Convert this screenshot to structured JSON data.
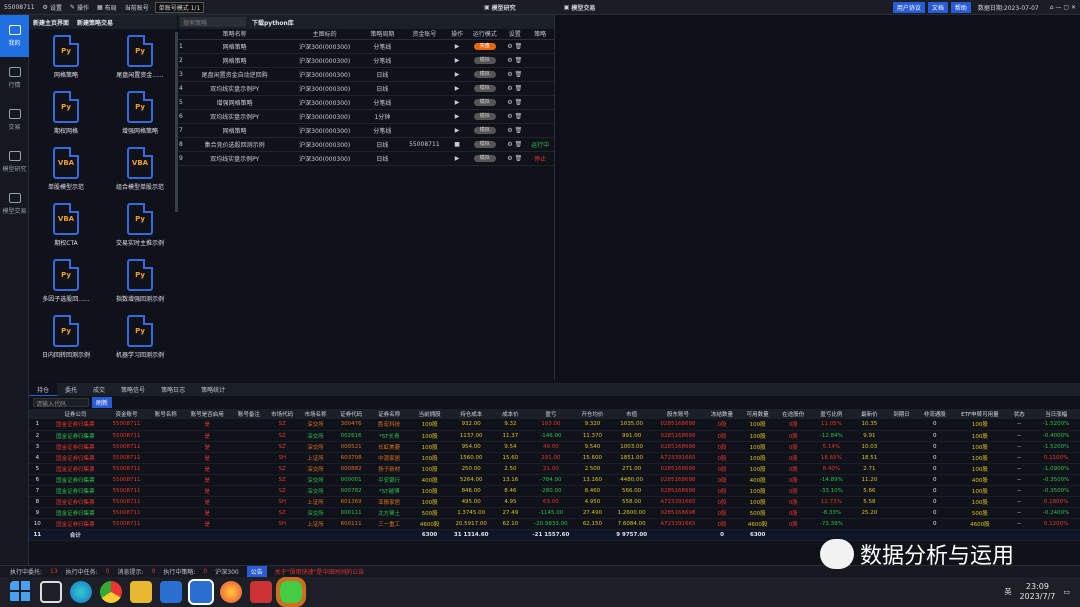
{
  "topbar": {
    "account": "55008711",
    "settings": "设置",
    "operate": "操作",
    "layout": "布局",
    "current_account": "当前账号",
    "mode": "单账号模式 1/1",
    "mid1": "模型研究",
    "mid2": "模型交易",
    "user_agreement": "用户协议",
    "docs": "文档",
    "help": "帮助",
    "date_label": "数据日期:2023-07-07"
  },
  "leftnav": [
    "我的",
    "行情",
    "交易",
    "模型研究",
    "模型交易"
  ],
  "strategy_tabs": [
    "新建主页界面",
    "新建策略交易"
  ],
  "strategies": [
    {
      "type": "Py",
      "name": "网格策略"
    },
    {
      "type": "Py",
      "name": "尾盘闲置资金......"
    },
    {
      "type": "Py",
      "name": "期权网格"
    },
    {
      "type": "Py",
      "name": "增强网格策略"
    },
    {
      "type": "VBA",
      "name": "单股模型示范"
    },
    {
      "type": "VBA",
      "name": "组合模型单股示范"
    },
    {
      "type": "VBA",
      "name": "期权CTA"
    },
    {
      "type": "Py",
      "name": "交易实时主推示例"
    },
    {
      "type": "Py",
      "name": "多因子选股回......"
    },
    {
      "type": "Py",
      "name": "指数增强回测示例"
    },
    {
      "type": "Py",
      "name": "日内回转回测示例"
    },
    {
      "type": "Py",
      "name": "机器学习回测示例"
    }
  ],
  "list": {
    "search_placeholder": "搜索策略",
    "download": "下载python库",
    "headers": [
      "",
      "策略名称",
      "主图标的",
      "策略周期",
      "资金账号",
      "操作",
      "运行模式",
      "设置",
      "策略"
    ],
    "rows": [
      [
        "1",
        "网格策略",
        "沪深300(000300)",
        "分笔线",
        "",
        "▶",
        "实盘",
        "",
        ""
      ],
      [
        "2",
        "网格策略",
        "沪深300(000300)",
        "分笔线",
        "",
        "▶",
        "模拟",
        "",
        ""
      ],
      [
        "3",
        "尾盘闲置资金自动逆回购",
        "沪深300(000300)",
        "日线",
        "",
        "▶",
        "模拟",
        "",
        ""
      ],
      [
        "4",
        "双均线实盘示例PY",
        "沪深300(000300)",
        "日线",
        "",
        "▶",
        "模拟",
        "",
        ""
      ],
      [
        "5",
        "增强网格策略",
        "沪深300(000300)",
        "分笔线",
        "",
        "▶",
        "模拟",
        "",
        ""
      ],
      [
        "6",
        "双均线实盘示例PY",
        "沪深300(000300)",
        "1分钟",
        "",
        "▶",
        "模拟",
        "",
        ""
      ],
      [
        "7",
        "网格策略",
        "沪深300(000300)",
        "分笔线",
        "",
        "▶",
        "模拟",
        "",
        ""
      ],
      [
        "8",
        "集合竞价选股回测示例",
        "沪深300(000300)",
        "日线",
        "55008711",
        "■",
        "模拟",
        "",
        "运行中"
      ],
      [
        "9",
        "双均线实盘示例PY",
        "沪深300(000300)",
        "日线",
        "",
        "▶",
        "模拟",
        "",
        "停止"
      ]
    ]
  },
  "bottom": {
    "tabs": [
      "持仓",
      "委托",
      "成交",
      "策略信号",
      "策略日志",
      "策略统计"
    ],
    "search_placeholder": "请输入代码",
    "search_btn": "刷新",
    "headers": [
      "",
      "证券公司",
      "资金账号",
      "账号名称",
      "账号是否启用",
      "账号备注",
      "市场代码",
      "市场名称",
      "证券代码",
      "证券名称",
      "当前拥股",
      "持仓成本",
      "成本价",
      "盈亏",
      "开仓均价",
      "市值",
      "股东账号",
      "冻结数量",
      "可用数量",
      "在途股份",
      "盈亏比例",
      "最新价",
      "到期日",
      "非流通股",
      "ETF申赎可用量",
      "状态",
      "当日涨幅"
    ],
    "rows": [
      [
        "1",
        "国金证券归集票",
        "55008711",
        "",
        "是",
        "",
        "SZ",
        "深交所",
        "300476",
        "胜宏科技",
        "100股",
        "932.00",
        "9.32",
        "103.00",
        "9.320",
        "1035.00",
        "0285168698",
        "0股",
        "100股",
        "0股",
        "11.05%",
        "10.35",
        "",
        "0",
        "100股",
        "--",
        "-1.5200%"
      ],
      [
        "2",
        "国金证券归集票",
        "55008711",
        "",
        "是",
        "",
        "SZ",
        "深交所",
        "002616",
        "*ST长青",
        "100股",
        "1137.00",
        "11.37",
        "-146.00",
        "11.370",
        "991.00",
        "0285168698",
        "0股",
        "100股",
        "0股",
        "-12.84%",
        "9.91",
        "",
        "0",
        "100股",
        "--",
        "-0.4000%"
      ],
      [
        "3",
        "国金证券归集票",
        "55008711",
        "",
        "是",
        "",
        "SZ",
        "深交所",
        "000521",
        "长虹美菱",
        "100股",
        "954.00",
        "9.54",
        "49.00",
        "9.540",
        "1003.00",
        "0285168698",
        "0股",
        "100股",
        "0股",
        "5.14%",
        "10.03",
        "",
        "0",
        "100股",
        "--",
        "-1.5200%"
      ],
      [
        "4",
        "国金证券归集票",
        "55008711",
        "",
        "是",
        "",
        "SH",
        "上证所",
        "603708",
        "中源家居",
        "100股",
        "1560.00",
        "15.60",
        "291.00",
        "15.600",
        "1851.00",
        "A723391665",
        "0股",
        "100股",
        "0股",
        "18.65%",
        "18.51",
        "",
        "0",
        "100股",
        "--",
        "0.1100%"
      ],
      [
        "5",
        "国金证券归集票",
        "55008711",
        "",
        "是",
        "",
        "SZ",
        "深交所",
        "000882",
        "扬子新材",
        "100股",
        "250.00",
        "2.50",
        "21.00",
        "2.500",
        "271.00",
        "0285168698",
        "0股",
        "100股",
        "0股",
        "8.40%",
        "2.71",
        "",
        "0",
        "100股",
        "--",
        "-1.0900%"
      ],
      [
        "6",
        "国金证券归集票",
        "55008711",
        "",
        "是",
        "",
        "SZ",
        "深交所",
        "000001",
        "平安银行",
        "400股",
        "5264.00",
        "13.16",
        "-784.00",
        "13.160",
        "4480.00",
        "0285168698",
        "0股",
        "400股",
        "0股",
        "-14.89%",
        "11.20",
        "",
        "0",
        "400股",
        "--",
        "-0.3500%"
      ],
      [
        "7",
        "国金证券归集票",
        "55008711",
        "",
        "是",
        "",
        "SZ",
        "深交所",
        "000782",
        "*ST越博",
        "100股",
        "846.00",
        "8.46",
        "-280.00",
        "8.460",
        "566.00",
        "0285168698",
        "0股",
        "100股",
        "0股",
        "-33.10%",
        "5.66",
        "",
        "0",
        "100股",
        "--",
        "-0.3500%"
      ],
      [
        "8",
        "国金证券归集票",
        "55008711",
        "",
        "是",
        "",
        "SH",
        "上证所",
        "601369",
        "亚振家居",
        "100股",
        "495.00",
        "4.95",
        "63.00",
        "4.950",
        "558.00",
        "A723391665",
        "0股",
        "100股",
        "0股",
        "12.73%",
        "5.58",
        "",
        "0",
        "100股",
        "--",
        "0.1800%"
      ],
      [
        "9",
        "国金证券归集票",
        "55008711",
        "",
        "是",
        "",
        "SZ",
        "深交所",
        "000111",
        "北方稀土",
        "500股",
        "1.3745.00",
        "27.49",
        "-1145.00",
        "27.490",
        "1.2600.00",
        "0285168698",
        "0股",
        "500股",
        "0股",
        "-8.33%",
        "25.20",
        "",
        "0",
        "500股",
        "--",
        "-0.2400%"
      ],
      [
        "10",
        "国金证券归集票",
        "55008711",
        "",
        "是",
        "",
        "SH",
        "上证所",
        "600111",
        "三一重工",
        "4600股",
        "20.5917.00",
        "62.10",
        "-20.9833.00",
        "62.150",
        "7.6084.00",
        "A723391665",
        "0股",
        "4600股",
        "0股",
        "-73.39%",
        "",
        "",
        "0",
        "4600股",
        "--",
        "0.1200%"
      ]
    ],
    "sum": [
      "11",
      "合计",
      "",
      "",
      "",
      "",
      "",
      "",
      "",
      "",
      "6300",
      "31 1314.60",
      "",
      "-21 1557.60",
      "",
      "9 9757.00",
      "",
      "0",
      "6300",
      "",
      "",
      "",
      "",
      "",
      "",
      "",
      ""
    ]
  },
  "status": {
    "pending": "执行中委托:",
    "pending_n": "13",
    "tasks": "执行中任务:",
    "tasks_n": "0",
    "alerts": "消息提示:",
    "alerts_n": "0",
    "running": "执行中策略:",
    "running_n": "0",
    "index": "沪深300",
    "notice_tag": "公告",
    "notice": "关于\"悟用快速\"是中国时间的公告"
  },
  "taskbar": {
    "time": "23:09",
    "date": "2023/7/7",
    "ime": "英"
  },
  "watermark": "数据分析与运用"
}
